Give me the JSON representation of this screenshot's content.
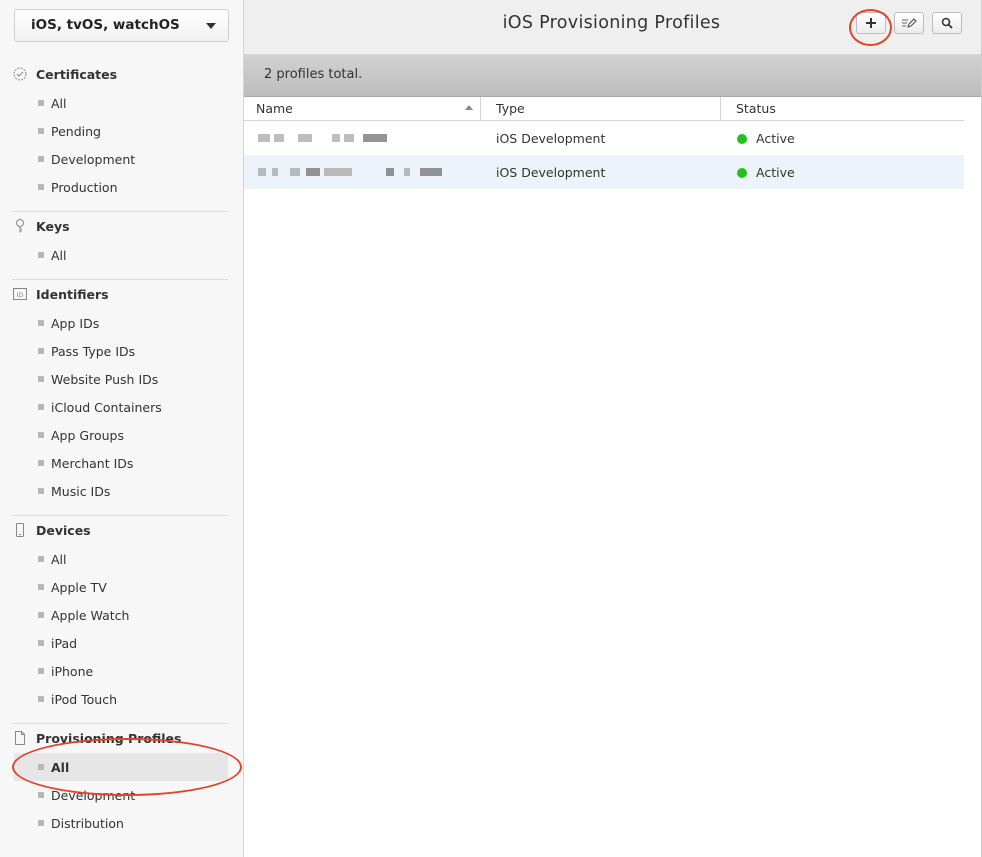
{
  "platform_select": {
    "value": "iOS, tvOS, watchOS"
  },
  "sidebar": {
    "sections": [
      {
        "title": "Certificates",
        "icon": "certificate-badge-icon",
        "items": [
          "All",
          "Pending",
          "Development",
          "Production"
        ]
      },
      {
        "title": "Keys",
        "icon": "key-icon",
        "items": [
          "All"
        ]
      },
      {
        "title": "Identifiers",
        "icon": "id-icon",
        "items": [
          "App IDs",
          "Pass Type IDs",
          "Website Push IDs",
          "iCloud Containers",
          "App Groups",
          "Merchant IDs",
          "Music IDs"
        ]
      },
      {
        "title": "Devices",
        "icon": "device-icon",
        "items": [
          "All",
          "Apple TV",
          "Apple Watch",
          "iPad",
          "iPhone",
          "iPod Touch"
        ]
      },
      {
        "title": "Provisioning Profiles",
        "icon": "document-icon",
        "items": [
          "All",
          "Development",
          "Distribution"
        ],
        "selected": "All"
      }
    ]
  },
  "header": {
    "title": "iOS Provisioning Profiles",
    "buttons": [
      {
        "name": "add-button",
        "icon": "plus-icon"
      },
      {
        "name": "edit-button",
        "icon": "edit-icon"
      },
      {
        "name": "search-button",
        "icon": "search-icon"
      }
    ]
  },
  "summary": {
    "text": "2 profiles total."
  },
  "table": {
    "columns": [
      "Name",
      "Type",
      "Status"
    ],
    "sort": {
      "column": "Name",
      "direction": "ascending"
    },
    "rows": [
      {
        "name_redacted": true,
        "type": "iOS Development",
        "status": "Active"
      },
      {
        "name_redacted": true,
        "type": "iOS Development",
        "status": "Active"
      }
    ]
  },
  "colors": {
    "status_active": "#22c31d",
    "annotation": "#e1442c",
    "row_alt": "#edf3fa"
  }
}
